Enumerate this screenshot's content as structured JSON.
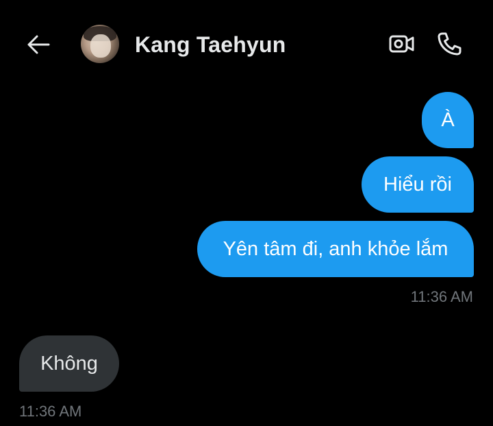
{
  "header": {
    "back_icon": "arrow-left-icon",
    "contact_name": "Kang Taehyun",
    "video_icon": "video-call-icon",
    "call_icon": "phone-icon"
  },
  "messages": [
    {
      "direction": "outgoing",
      "text": "À"
    },
    {
      "direction": "outgoing",
      "text": "Hiểu rồi"
    },
    {
      "direction": "outgoing",
      "text": "Yên tâm đi, anh khỏe lắm"
    },
    {
      "direction": "incoming",
      "text": "Không"
    }
  ],
  "timestamps": {
    "outgoing_group": "11:36 AM",
    "incoming_group": "11:36 AM"
  },
  "colors": {
    "background": "#000000",
    "outgoing_bubble": "#1d9bf0",
    "incoming_bubble": "#2f3336",
    "primary_text": "#e7e9ea",
    "secondary_text": "#71767b"
  }
}
